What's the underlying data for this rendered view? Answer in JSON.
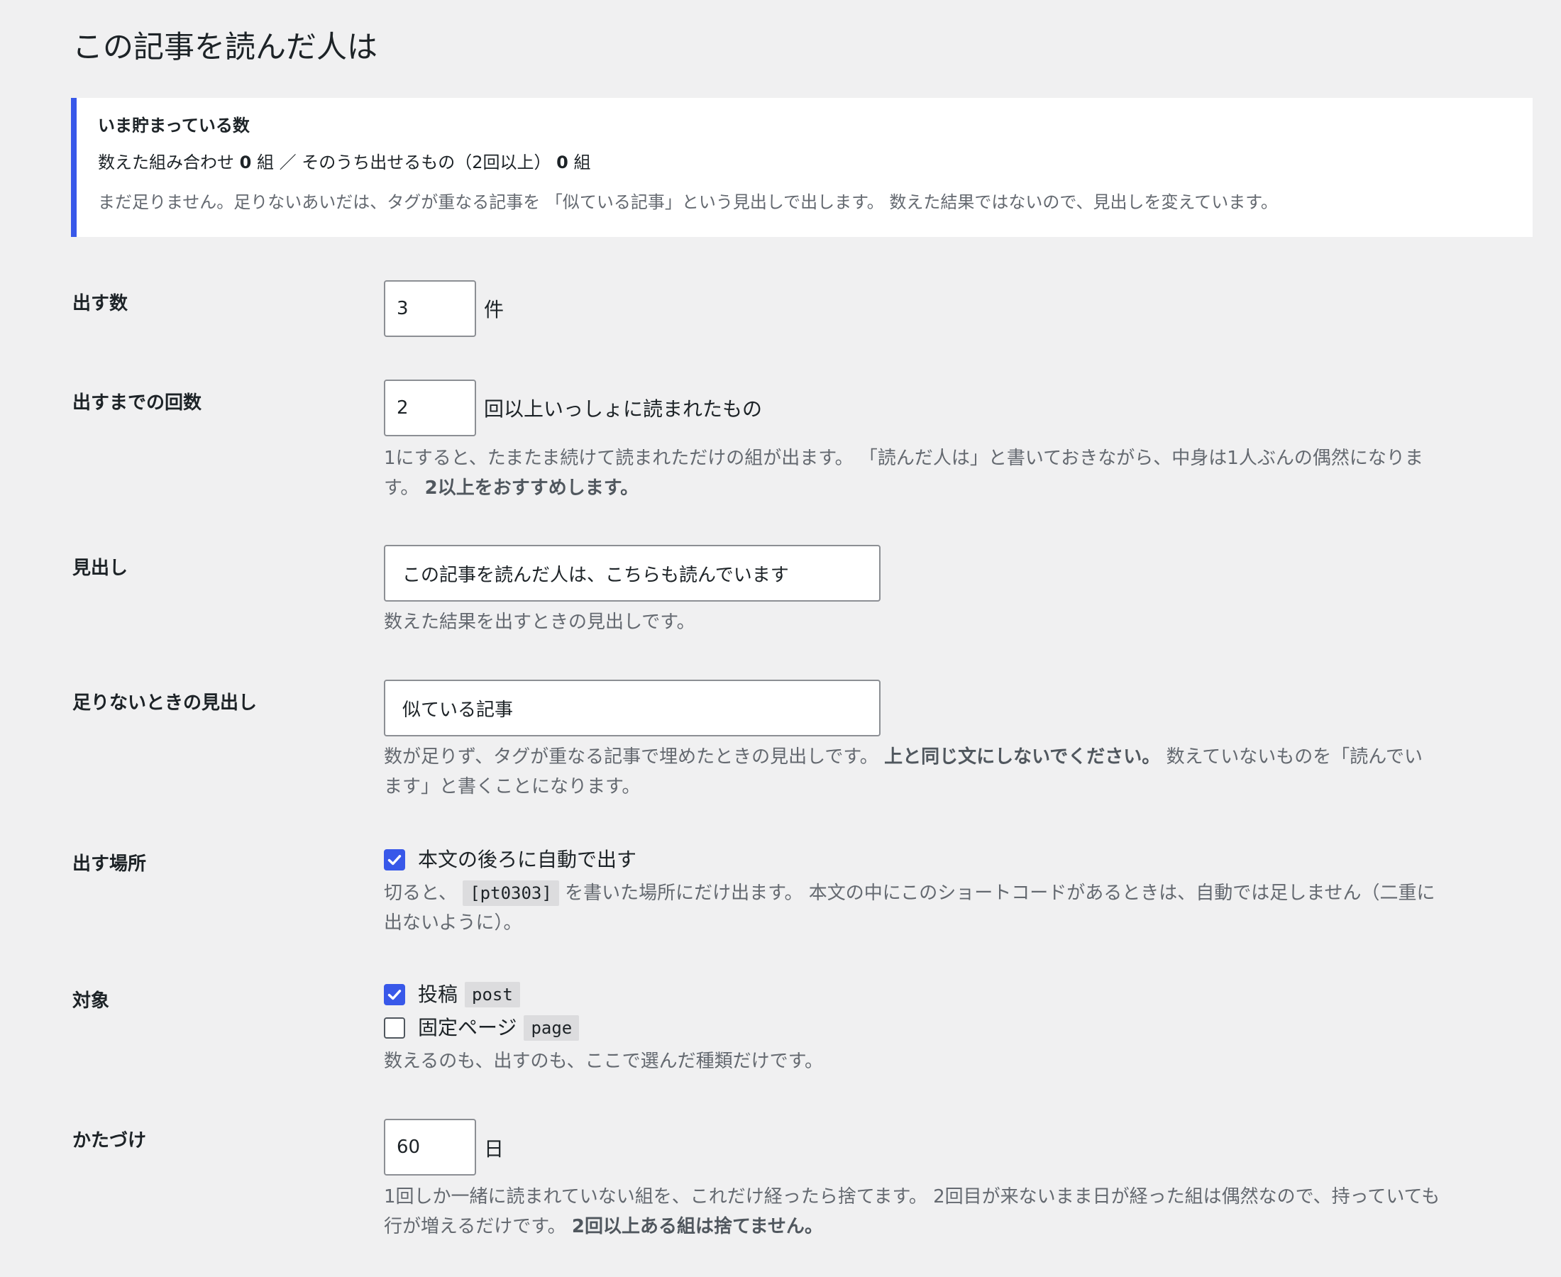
{
  "page": {
    "title": "この記事を読んだ人は"
  },
  "notice": {
    "title": "いま貯まっている数",
    "counts": {
      "counted_label": "数えた組み合わせ",
      "counted_value": "0",
      "counted_unit": "組 ／ そのうち出せるもの（2回以上）",
      "usable_value": "0",
      "usable_unit": "組"
    },
    "description": "まだ足りません。足りないあいだは、タグが重なる記事を 「似ている記事」という見出しで出します。 数えた結果ではないので、見出しを変えています。"
  },
  "fields": {
    "count": {
      "label": "出す数",
      "value": "3",
      "suffix": "件"
    },
    "threshold": {
      "label": "出すまでの回数",
      "value": "2",
      "suffix": "回以上いっしょに読まれたもの",
      "desc_line1": "1にすると、たまたま続けて読まれただけの組が出ます。 「読んだ人は」と書いておきながら、中身は1人ぶんの偶然になりま",
      "desc_line2_text": "す。 ",
      "desc_line2_strong": "2以上をおすすめします。"
    },
    "heading": {
      "label": "見出し",
      "value": "この記事を読んだ人は、こちらも読んでいます",
      "desc": "数えた結果を出すときの見出しです。"
    },
    "fallback_heading": {
      "label": "足りないときの見出し",
      "value": "似ている記事",
      "desc_text": "数が足りず、タグが重なる記事で埋めたときの見出しです。 ",
      "desc_strong": "上と同じ文にしないでください。",
      "desc_after_line1": " 数えていないものを「読んでい",
      "desc_line2": "ます」と書くことになります。"
    },
    "placement": {
      "label": "出す場所",
      "checkbox_label": "本文の後ろに自動で出す",
      "checked": true,
      "desc_before": "切ると、 ",
      "desc_code": "[pt0303]",
      "desc_after_line1": " を書いた場所にだけ出ます。 本文の中にこのショートコードがあるときは、自動では足しません（二重に",
      "desc_line2": "出ないように）。"
    },
    "targets": {
      "label": "対象",
      "options": [
        {
          "label": "投稿",
          "code": "post",
          "checked": true
        },
        {
          "label": "固定ページ",
          "code": "page",
          "checked": false
        }
      ],
      "desc": "数えるのも、出すのも、ここで選んだ種類だけです。"
    },
    "cleanup": {
      "label": "かたづけ",
      "value": "60",
      "suffix": "日",
      "desc_line1": "1回しか一緒に読まれていない組を、これだけ経ったら捨てます。 2回目が来ないまま日が経った組は偶然なので、持っていても",
      "desc_line2_text": "行が増えるだけです。 ",
      "desc_line2_strong": "2回以上ある組は捨てません。"
    }
  },
  "colors": {
    "background": "#f0f0f1",
    "notice_border": "#3858e9",
    "checkbox_checked": "#3858e9",
    "text": "#1d2327",
    "description_text": "#646970"
  },
  "icons": {
    "checkmark": "checkmark-icon"
  }
}
